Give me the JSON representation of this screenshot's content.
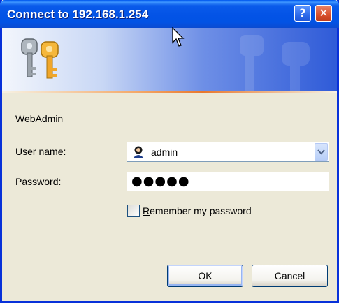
{
  "window": {
    "title": "Connect to 192.168.1.254"
  },
  "titlebar": {
    "help_glyph": "?",
    "close_glyph": "✕"
  },
  "form": {
    "realm": "WebAdmin",
    "user_label_accel": "U",
    "user_label_rest": "ser name:",
    "user_value": "admin",
    "pass_label_accel": "P",
    "pass_label_rest": "assword:",
    "pass_masked": "●●●●●",
    "remember_accel": "R",
    "remember_rest": "emember my password",
    "remember_checked": false
  },
  "buttons": {
    "ok": "OK",
    "cancel": "Cancel"
  },
  "icons": {
    "banner": "keys-icon",
    "user": "user-icon",
    "dropdown": "chevron-down-icon",
    "cursor": "mouse-pointer-icon"
  },
  "colors": {
    "titlebar": "#0A5BEA",
    "dialog_bg": "#ECE9D8",
    "close": "#D9502C",
    "banner_accent": "#E8782E"
  }
}
